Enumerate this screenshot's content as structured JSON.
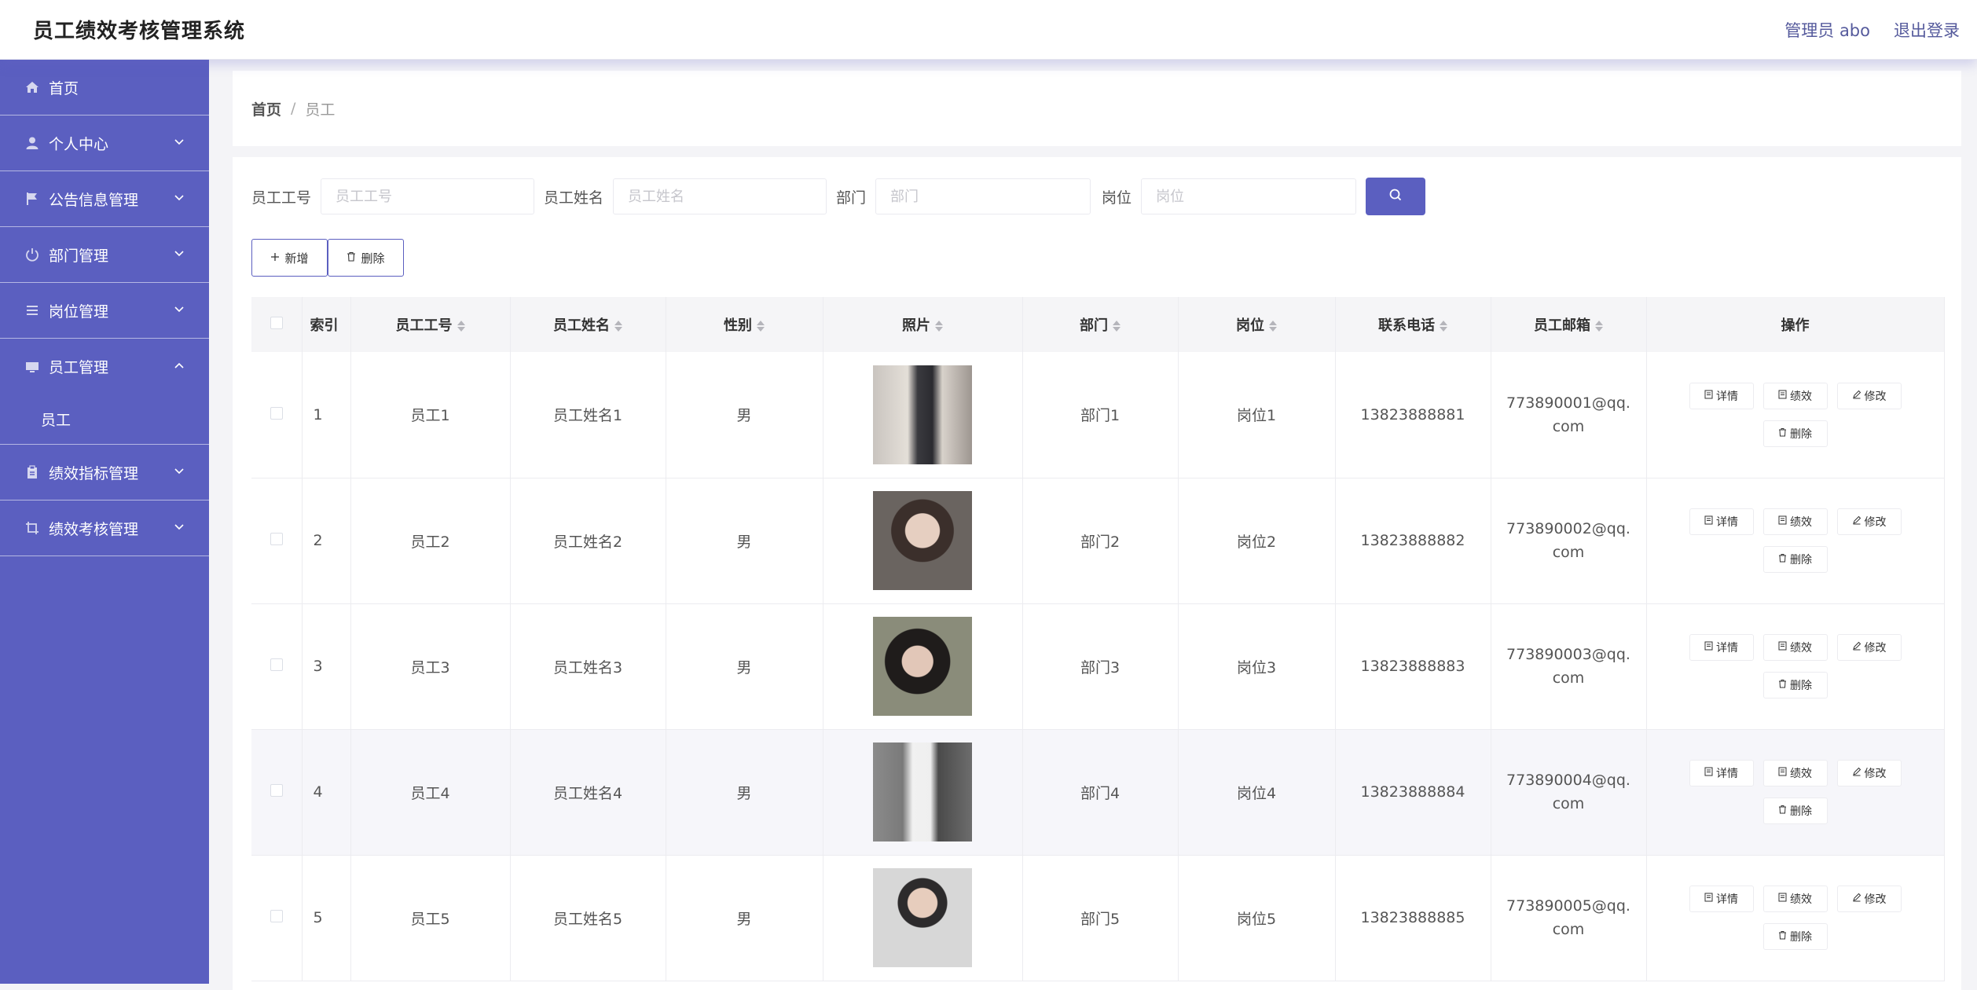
{
  "header": {
    "title": "员工绩效考核管理系统",
    "user": "管理员 abo",
    "logout": "退出登录"
  },
  "sidebar": {
    "items": [
      {
        "label": "首页",
        "icon": "home-icon"
      },
      {
        "label": "个人中心",
        "icon": "user-icon"
      },
      {
        "label": "公告信息管理",
        "icon": "flag-icon"
      },
      {
        "label": "部门管理",
        "icon": "power-icon"
      },
      {
        "label": "岗位管理",
        "icon": "list-icon"
      },
      {
        "label": "员工管理",
        "icon": "monitor-icon"
      },
      {
        "label": "绩效指标管理",
        "icon": "clipboard-icon"
      },
      {
        "label": "绩效考核管理",
        "icon": "crop-icon"
      }
    ],
    "sub_item": "员工"
  },
  "breadcrumb": {
    "home": "首页",
    "sep": "/",
    "current": "员工"
  },
  "search": {
    "emp_no_label": "员工工号",
    "emp_no_placeholder": "员工工号",
    "emp_name_label": "员工姓名",
    "emp_name_placeholder": "员工姓名",
    "dept_label": "部门",
    "dept_placeholder": "部门",
    "post_label": "岗位",
    "post_placeholder": "岗位"
  },
  "actions": {
    "add": "新增",
    "delete": "删除"
  },
  "table": {
    "headers": [
      "索引",
      "员工工号",
      "员工姓名",
      "性别",
      "照片",
      "部门",
      "岗位",
      "联系电话",
      "员工邮箱",
      "操作"
    ],
    "op_labels": {
      "detail": "详情",
      "perf": "绩效",
      "edit": "修改",
      "delete": "删除"
    },
    "rows": [
      {
        "idx": "1",
        "no": "员工1",
        "name": "员工姓名1",
        "sex": "男",
        "dept": "部门1",
        "post": "岗位1",
        "phone": "13823888881",
        "email": "773890001@qq.com"
      },
      {
        "idx": "2",
        "no": "员工2",
        "name": "员工姓名2",
        "sex": "男",
        "dept": "部门2",
        "post": "岗位2",
        "phone": "13823888882",
        "email": "773890002@qq.com"
      },
      {
        "idx": "3",
        "no": "员工3",
        "name": "员工姓名3",
        "sex": "男",
        "dept": "部门3",
        "post": "岗位3",
        "phone": "13823888883",
        "email": "773890003@qq.com"
      },
      {
        "idx": "4",
        "no": "员工4",
        "name": "员工姓名4",
        "sex": "男",
        "dept": "部门4",
        "post": "岗位4",
        "phone": "13823888884",
        "email": "773890004@qq.com"
      },
      {
        "idx": "5",
        "no": "员工5",
        "name": "员工姓名5",
        "sex": "男",
        "dept": "部门5",
        "post": "岗位5",
        "phone": "13823888885",
        "email": "773890005@qq.com"
      }
    ]
  },
  "colors": {
    "accent": "#5b5fc0",
    "sidebar_bg": "#5b5fc0"
  }
}
